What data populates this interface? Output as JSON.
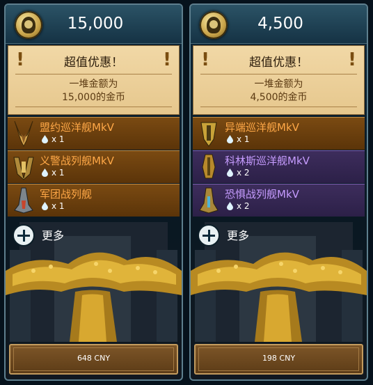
{
  "cards": [
    {
      "price": "15,000",
      "offer_title": "超值优惠！",
      "offer_line1": "一堆金额为",
      "offer_line2": "15,000的金币",
      "items": [
        {
          "name": "盟约巡洋舰MkV",
          "qty": "x 1",
          "rarity": "orange",
          "icon": "cruiser-ship-icon"
        },
        {
          "name": "义警战列舰MkV",
          "qty": "x 1",
          "rarity": "orange",
          "icon": "battleship-icon"
        },
        {
          "name": "军团战列舰",
          "qty": "x 1",
          "rarity": "orange",
          "icon": "battleship-icon"
        }
      ],
      "more_label": "更多",
      "buy_label": "648 CNY"
    },
    {
      "price": "4,500",
      "offer_title": "超值优惠！",
      "offer_line1": "一堆金额为",
      "offer_line2": "4,500的金币",
      "items": [
        {
          "name": "异端巡洋舰MkV",
          "qty": "x 1",
          "rarity": "orange",
          "icon": "cruiser-ship-icon"
        },
        {
          "name": "科林斯巡洋舰MkV",
          "qty": "x 2",
          "rarity": "purple",
          "icon": "cruiser-ship-icon"
        },
        {
          "name": "恐惧战列舰MkV",
          "qty": "x 2",
          "rarity": "purple",
          "icon": "battleship-icon"
        }
      ],
      "more_label": "更多",
      "buy_label": "198 CNY"
    }
  ],
  "colors": {
    "orange_item_text": "#ffa847",
    "purple_item_text": "#c69cff",
    "offer_bg": "#f1d8a6",
    "frame": "#5e7f8e"
  }
}
